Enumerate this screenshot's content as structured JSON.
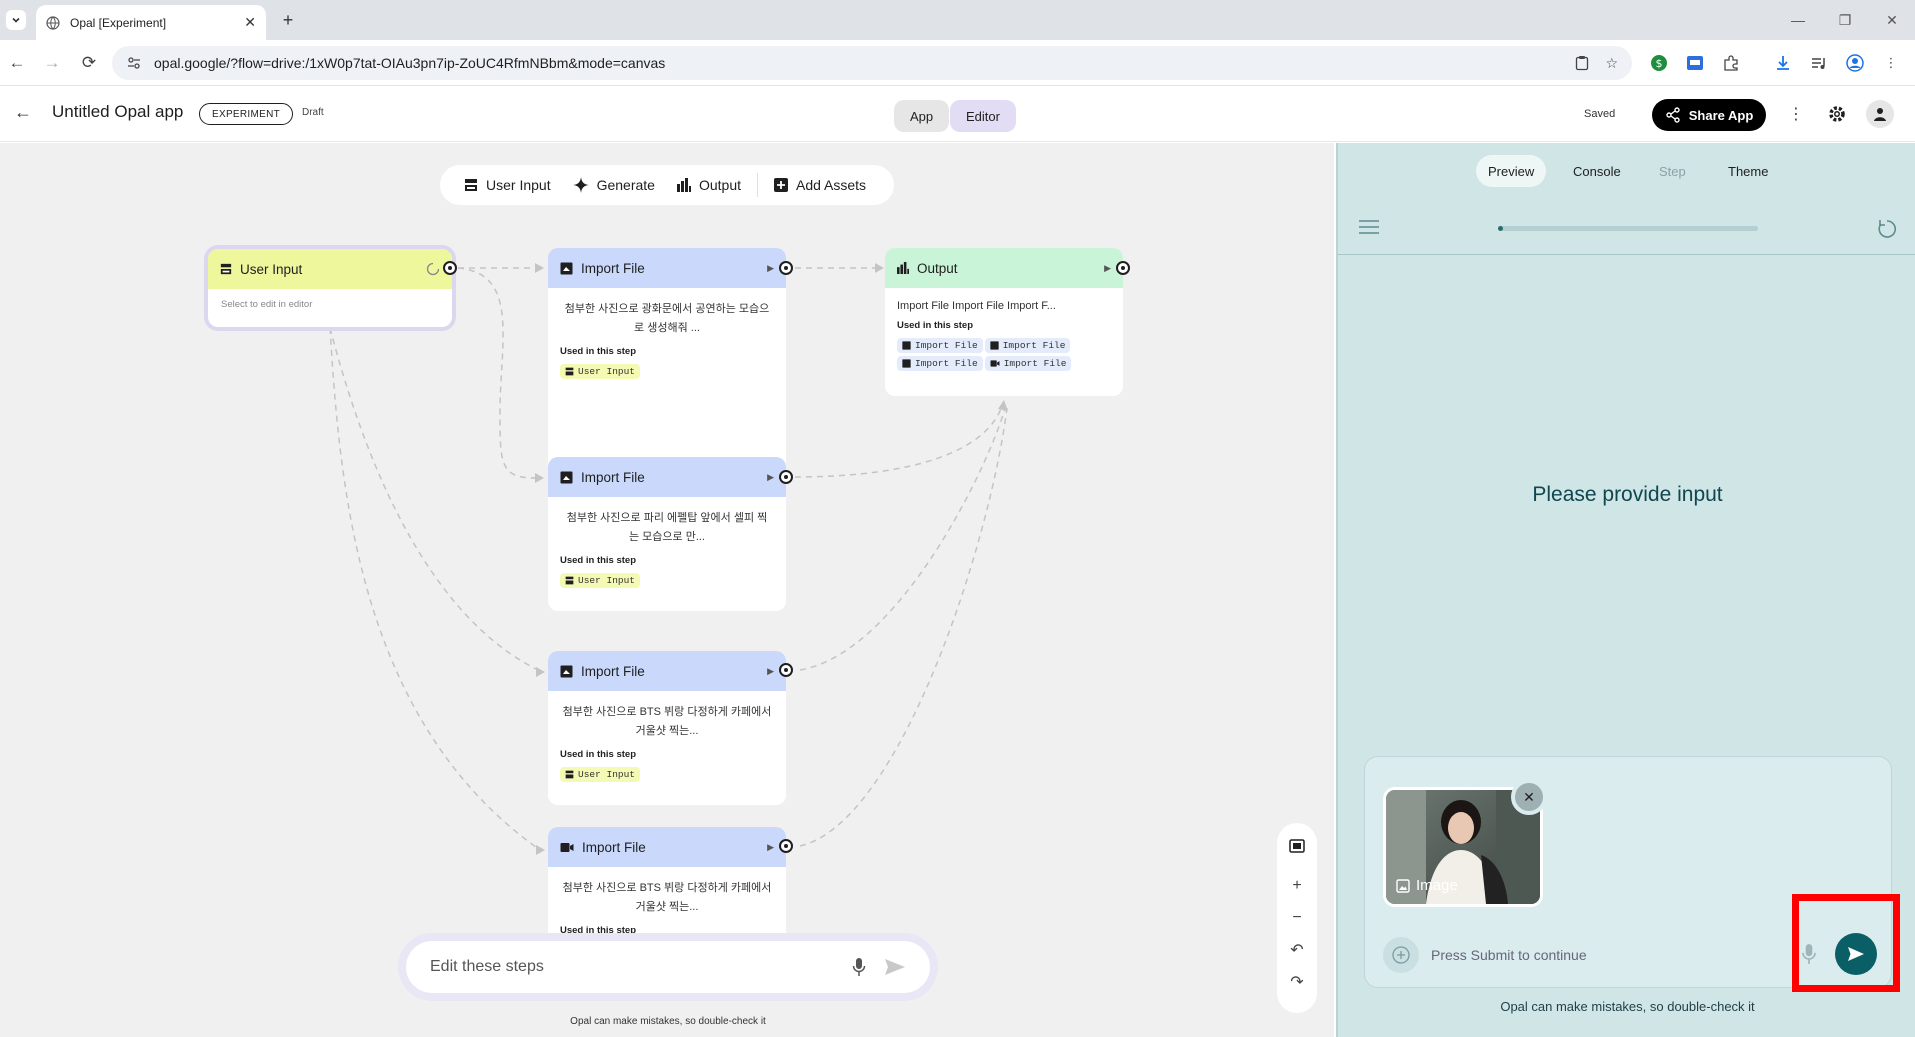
{
  "browser": {
    "tab_title": "Opal [Experiment]",
    "url": "opal.google/?flow=drive:/1xW0p7tat-OIAu3pn7ip-ZoUC4RfmNBbm&mode=canvas"
  },
  "header": {
    "app_title": "Untitled Opal app",
    "badge": "EXPERIMENT",
    "status": "Draft",
    "mode_app": "App",
    "mode_editor": "Editor",
    "saved": "Saved",
    "share_label": "Share App"
  },
  "toolbar": {
    "user_input": "User Input",
    "generate": "Generate",
    "output": "Output",
    "add_assets": "Add Assets"
  },
  "nodes": {
    "user_input": {
      "title": "User Input",
      "hint": "Select to edit in editor"
    },
    "import1": {
      "title": "Import File",
      "desc": "첨부한 사진으로 광화문에서 공연하는 모습으로 생성해줘 ...",
      "used": "Used in this step",
      "chip": "User Input"
    },
    "import2": {
      "title": "Import File",
      "desc": "첨부한 사진으로 파리 에펠탑 앞에서 셀피 찍는 모습으로 만...",
      "used": "Used in this step",
      "chip": "User Input"
    },
    "import3": {
      "title": "Import File",
      "desc": "첨부한 사진으로 BTS 뷔랑 다정하게 카페에서 거울샷 찍는...",
      "used": "Used in this step",
      "chip": "User Input"
    },
    "import4": {
      "title": "Import File",
      "desc": "첨부한 사진으로 BTS 뷔랑 다정하게 카페에서 거울샷 찍는...",
      "used": "Used in this step"
    },
    "output": {
      "title": "Output",
      "desc": "Import File Import File Import F...",
      "used": "Used in this step",
      "chips": [
        "Import File",
        "Import File",
        "Import File",
        "Import File"
      ]
    }
  },
  "editor": {
    "placeholder": "Edit these steps",
    "disclaimer": "Opal can make mistakes, so double-check it"
  },
  "panel": {
    "tabs": [
      "Preview",
      "Console",
      "Step",
      "Theme"
    ],
    "prompt": "Please provide input",
    "attachment_label": "Image",
    "input_placeholder": "Press Submit to continue",
    "disclaimer": "Opal can make mistakes, so double-check it",
    "progress": 0.02
  },
  "colors": {
    "user_input_head": "#eef79c",
    "import_head": "#c9d8fb",
    "output_head": "#c9f4d7",
    "panel_bg": "#cfe5e6",
    "send_button": "#0a5e66",
    "highlight": "#ff0000"
  }
}
